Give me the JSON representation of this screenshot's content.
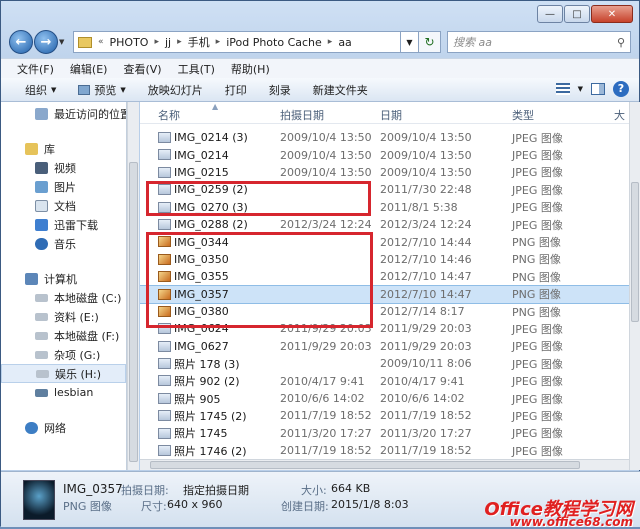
{
  "address": {
    "segments": [
      "PHOTO",
      "jj",
      "手机",
      "iPod Photo Cache",
      "aa"
    ],
    "search_placeholder": "搜索 aa"
  },
  "menu": [
    "文件(F)",
    "编辑(E)",
    "查看(V)",
    "工具(T)",
    "帮助(H)"
  ],
  "toolbar": {
    "organize": "组织",
    "preview": "预览",
    "slideshow": "放映幻灯片",
    "print": "打印",
    "burn": "刻录",
    "new_folder": "新建文件夹"
  },
  "nav": {
    "recent": "最近访问的位置",
    "library": "库",
    "video": "视频",
    "pictures": "图片",
    "documents": "文档",
    "thunder": "迅雷下载",
    "music": "音乐",
    "computer": "计算机",
    "drive_c": "本地磁盘 (C:)",
    "drive_e": "资料 (E:)",
    "drive_f": "本地磁盘 (F:)",
    "drive_g": "杂项 (G:)",
    "drive_h": "娱乐 (H:)",
    "lesbian": "lesbian",
    "network": "网络"
  },
  "columns": {
    "name": "名称",
    "taken": "拍摄日期",
    "date": "日期",
    "type": "类型",
    "extra": "大"
  },
  "files": [
    {
      "name": "IMG_0214 (3)",
      "taken": "2009/10/4 13:50",
      "date": "2009/10/4 13:50",
      "type": "JPEG 图像",
      "kind": "jpg"
    },
    {
      "name": "IMG_0214",
      "taken": "2009/10/4 13:50",
      "date": "2009/10/4 13:50",
      "type": "JPEG 图像",
      "kind": "jpg"
    },
    {
      "name": "IMG_0215",
      "taken": "2009/10/4 13:50",
      "date": "2009/10/4 13:50",
      "type": "JPEG 图像",
      "kind": "jpg"
    },
    {
      "name": "IMG_0259 (2)",
      "taken": "",
      "date": "2011/7/30 22:48",
      "type": "JPEG 图像",
      "kind": "jpg"
    },
    {
      "name": "IMG_0270 (3)",
      "taken": "",
      "date": "2011/8/1 5:38",
      "type": "JPEG 图像",
      "kind": "jpg"
    },
    {
      "name": "IMG_0288 (2)",
      "taken": "2012/3/24 12:24",
      "date": "2012/3/24 12:24",
      "type": "JPEG 图像",
      "kind": "jpg"
    },
    {
      "name": "IMG_0344",
      "taken": "",
      "date": "2012/7/10 14:44",
      "type": "PNG 图像",
      "kind": "png"
    },
    {
      "name": "IMG_0350",
      "taken": "",
      "date": "2012/7/10 14:46",
      "type": "PNG 图像",
      "kind": "png"
    },
    {
      "name": "IMG_0355",
      "taken": "",
      "date": "2012/7/10 14:47",
      "type": "PNG 图像",
      "kind": "png"
    },
    {
      "name": "IMG_0357",
      "taken": "",
      "date": "2012/7/10 14:47",
      "type": "PNG 图像",
      "kind": "png",
      "selected": true
    },
    {
      "name": "IMG_0380",
      "taken": "",
      "date": "2012/7/14 8:17",
      "type": "PNG 图像",
      "kind": "png"
    },
    {
      "name": "IMG_0624",
      "taken": "2011/9/29 20:03",
      "date": "2011/9/29 20:03",
      "type": "JPEG 图像",
      "kind": "jpg"
    },
    {
      "name": "IMG_0627",
      "taken": "2011/9/29 20:03",
      "date": "2011/9/29 20:03",
      "type": "JPEG 图像",
      "kind": "jpg"
    },
    {
      "name": "照片 178 (3)",
      "taken": "",
      "date": "2009/10/11 8:06",
      "type": "JPEG 图像",
      "kind": "jpg"
    },
    {
      "name": "照片 902 (2)",
      "taken": "2010/4/17 9:41",
      "date": "2010/4/17 9:41",
      "type": "JPEG 图像",
      "kind": "jpg"
    },
    {
      "name": "照片 905",
      "taken": "2010/6/6 14:02",
      "date": "2010/6/6 14:02",
      "type": "JPEG 图像",
      "kind": "jpg"
    },
    {
      "name": "照片 1745 (2)",
      "taken": "2011/7/19 18:52",
      "date": "2011/7/19 18:52",
      "type": "JPEG 图像",
      "kind": "jpg"
    },
    {
      "name": "照片 1745",
      "taken": "2011/3/20 17:27",
      "date": "2011/3/20 17:27",
      "type": "JPEG 图像",
      "kind": "jpg"
    },
    {
      "name": "照片 1746 (2)",
      "taken": "2011/7/19 18:52",
      "date": "2011/7/19 18:52",
      "type": "JPEG 图像",
      "kind": "jpg"
    }
  ],
  "details": {
    "filename": "IMG_0357",
    "filetype": "PNG 图像",
    "taken_label": "拍摄日期:",
    "taken_value": "指定拍摄日期",
    "dims_label": "尺寸:",
    "dims_value": "640 x 960",
    "size_label": "大小:",
    "size_value": "664 KB",
    "created_label": "创建日期:",
    "created_value": "2015/1/8 8:03"
  },
  "watermark": {
    "main": "Office教程学习网",
    "url": "www.office68.com"
  }
}
